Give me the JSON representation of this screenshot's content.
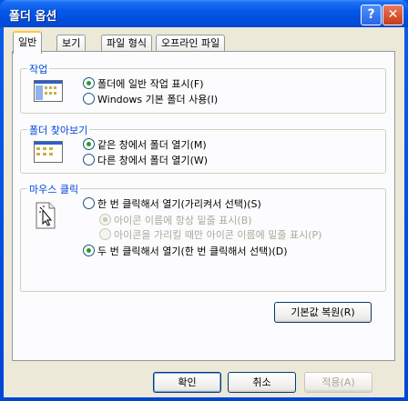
{
  "window": {
    "title": "폴더 옵션",
    "help_glyph": "?",
    "close_glyph": "✕"
  },
  "tabs": [
    {
      "label": "일반"
    },
    {
      "label": "보기"
    },
    {
      "label": "파일 형식"
    },
    {
      "label": "오프라인 파일"
    }
  ],
  "tasks": {
    "title": "작업",
    "options": [
      {
        "label": "폴더에 일반 작업 표시(F)",
        "checked": true
      },
      {
        "label": "Windows 기본 폴더 사용(I)",
        "checked": false
      }
    ]
  },
  "browse": {
    "title": "폴더 찾아보기",
    "options": [
      {
        "label": "같은 창에서 폴더 열기(M)",
        "checked": true
      },
      {
        "label": "다른 창에서 폴더 열기(W)",
        "checked": false
      }
    ]
  },
  "click": {
    "title": "마우스 클릭",
    "single": {
      "label": "한 번 클릭해서 열기(가리켜서 선택)(S)",
      "checked": false
    },
    "sub": [
      {
        "label": "아이콘 이름에 항상 밑줄 표시(B)",
        "checked": true
      },
      {
        "label": "아이콘을 가리킬 때만 아이콘 이름에 밑줄 표시(P)",
        "checked": false
      }
    ],
    "double": {
      "label": "두 번 클릭해서 열기(한 번 클릭해서 선택)(D)",
      "checked": true
    }
  },
  "restore_button": "기본값 복원(R)",
  "footer": {
    "ok": "확인",
    "cancel": "취소",
    "apply": "적용(A)"
  }
}
